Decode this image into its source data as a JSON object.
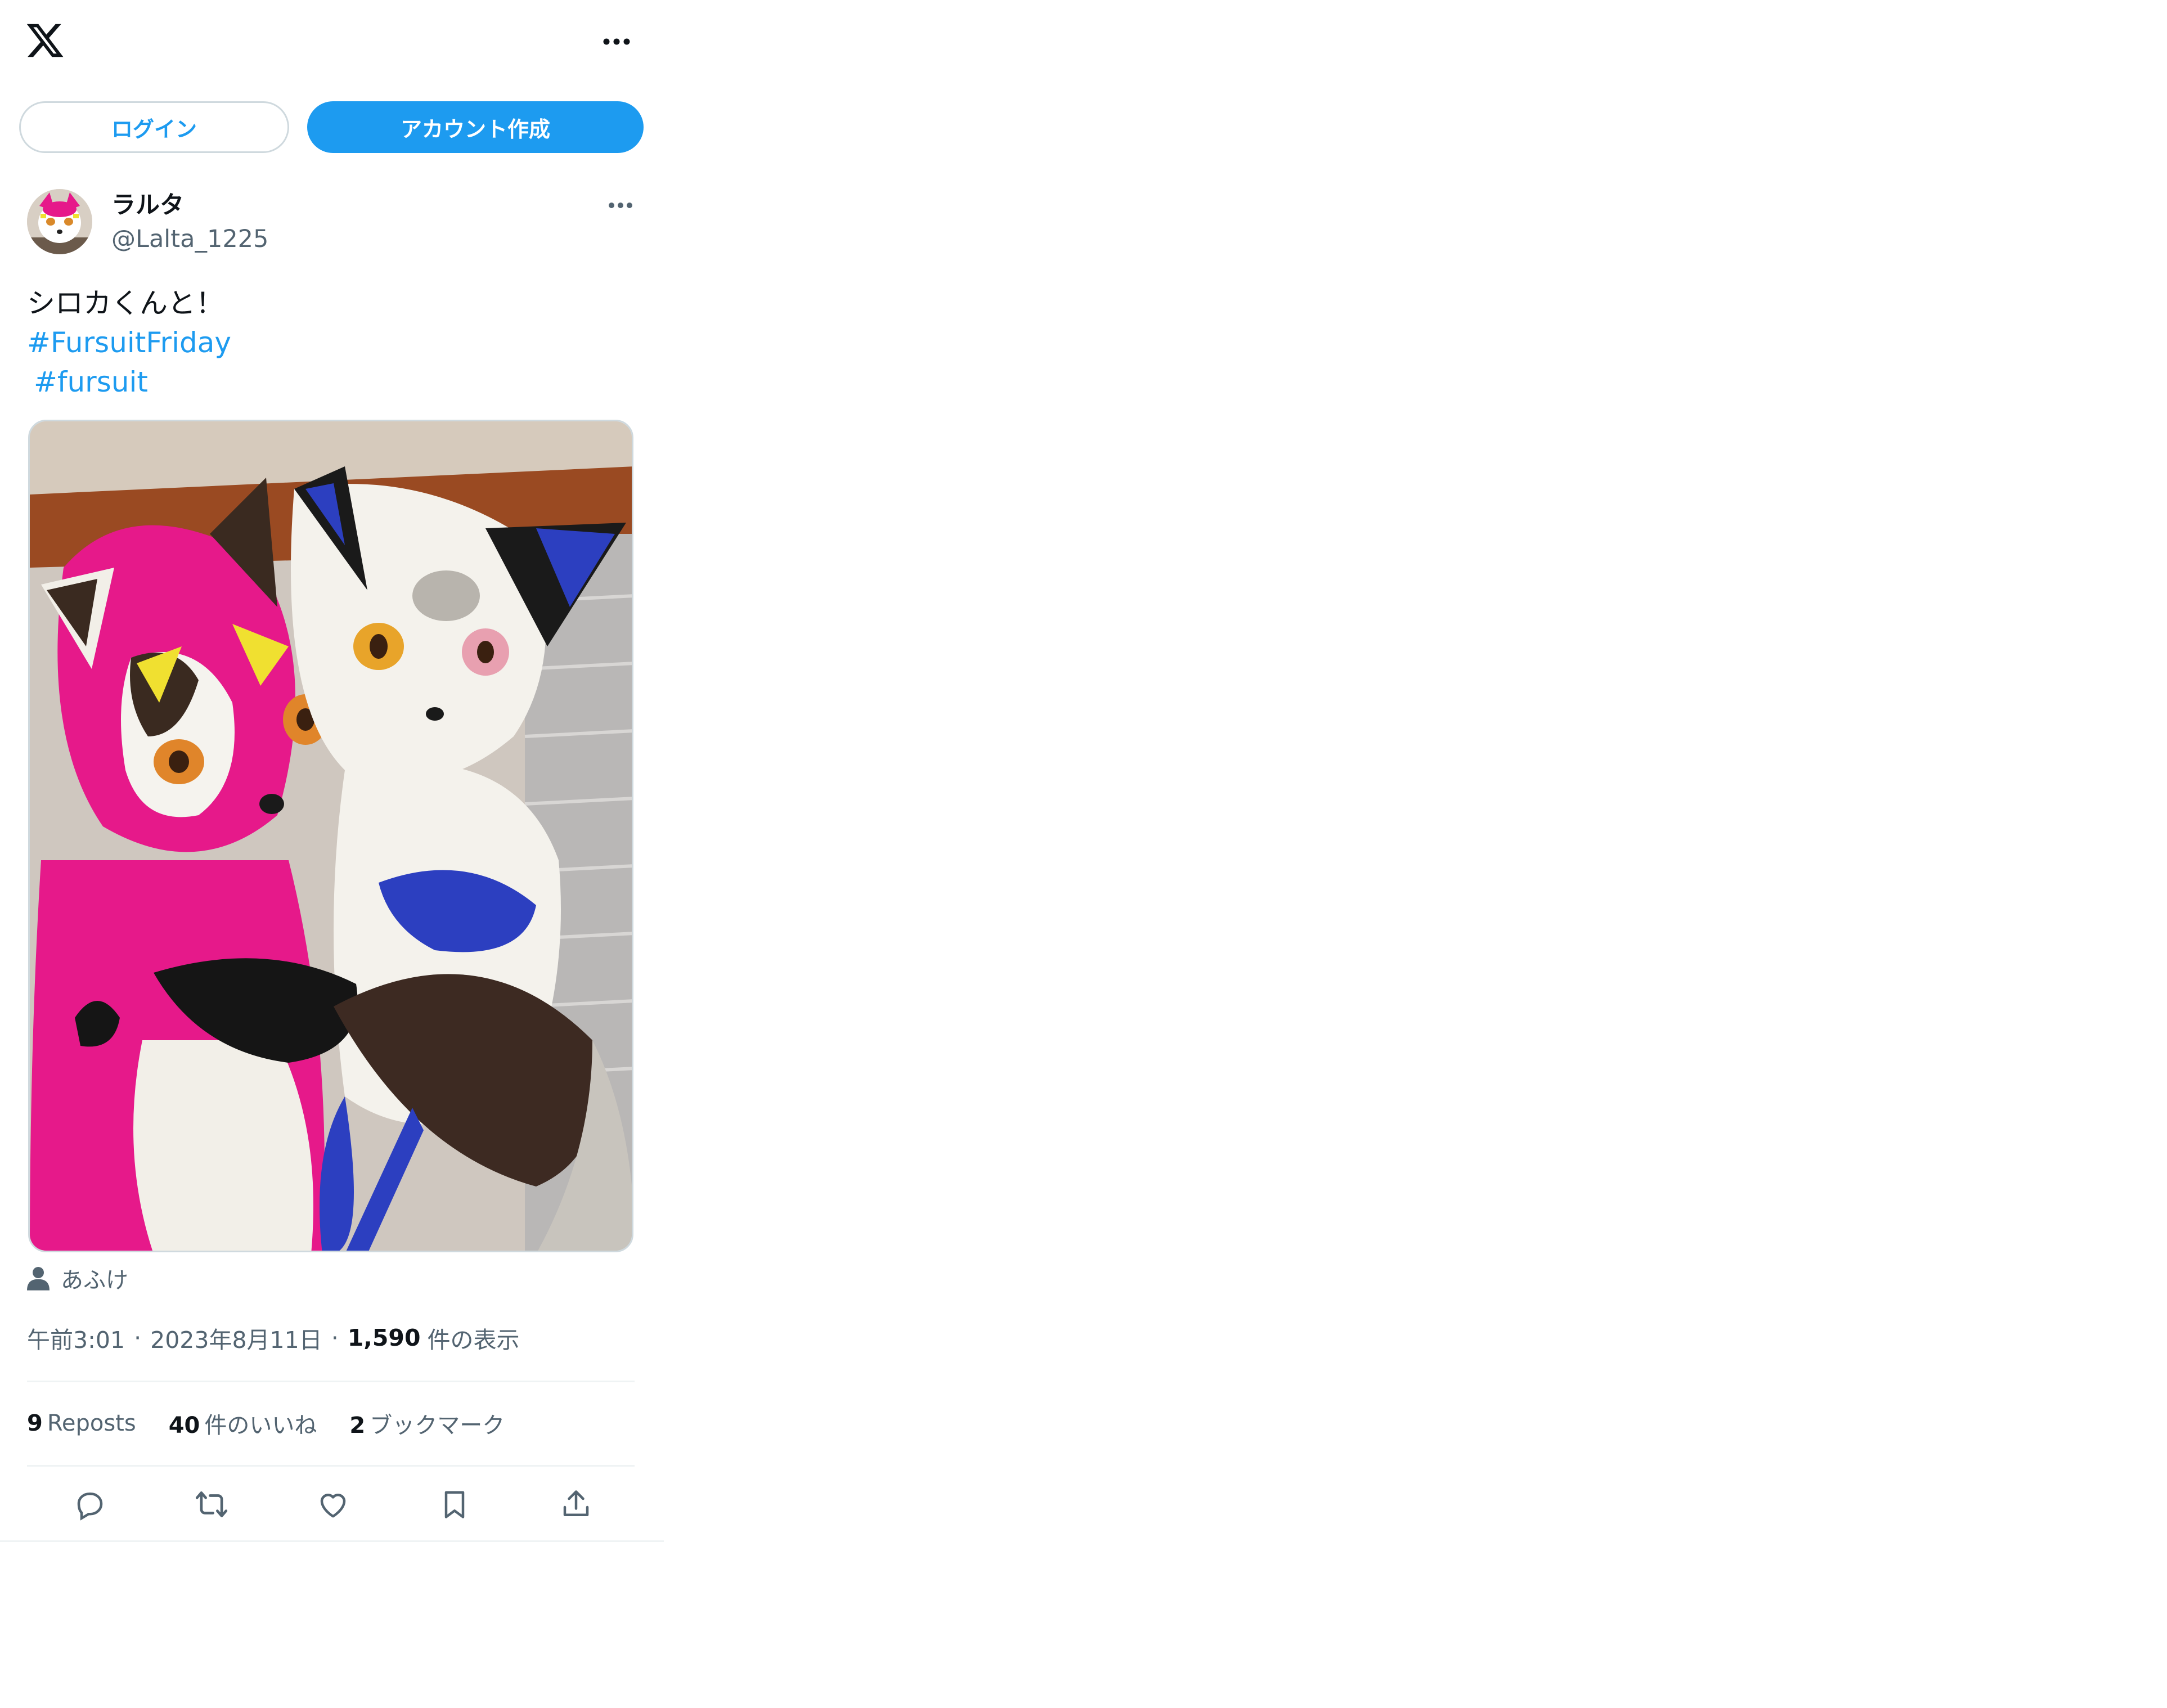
{
  "header": {
    "logo_icon": "x-logo-icon",
    "more_icon": "more-horizontal-icon"
  },
  "auth": {
    "login_label": "ログイン",
    "signup_label": "アカウント作成"
  },
  "post": {
    "author_name": "ラルタ",
    "author_handle": "@Lalta_1225",
    "text_line1": "シロカくんと！",
    "hashtag1": "#FursuitFriday",
    "hashtag2": "#fursuit",
    "tagged_user": "あふけ",
    "time": "午前3:01",
    "date": "2023年8月11日",
    "dot": "·",
    "views_count": "1,590",
    "views_label": "件の表示",
    "reposts_count": "9",
    "reposts_label": "Reposts",
    "likes_count": "40",
    "likes_label": "件のいいね",
    "bookmarks_count": "2",
    "bookmarks_label": "ブックマーク"
  },
  "colors": {
    "accent": "#1d9bf0",
    "text": "#0f1419",
    "muted": "#536471",
    "border": "#cfd9de"
  },
  "action_icons": [
    "reply-icon",
    "repost-icon",
    "like-icon",
    "bookmark-icon",
    "share-icon"
  ]
}
